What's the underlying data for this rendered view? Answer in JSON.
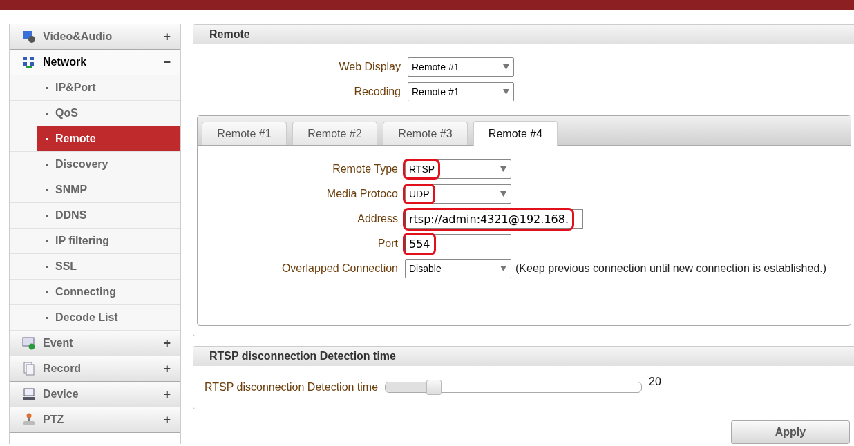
{
  "sidebar": {
    "sections": [
      {
        "kind": "video",
        "label": "Video&Audio",
        "toggle": "+",
        "expanded": false
      },
      {
        "kind": "network",
        "label": "Network",
        "toggle": "−",
        "expanded": true,
        "children": [
          {
            "label": "IP&Port",
            "selected": false
          },
          {
            "label": "QoS",
            "selected": false
          },
          {
            "label": "Remote",
            "selected": true
          },
          {
            "label": "Discovery",
            "selected": false
          },
          {
            "label": "SNMP",
            "selected": false
          },
          {
            "label": "DDNS",
            "selected": false
          },
          {
            "label": "IP filtering",
            "selected": false
          },
          {
            "label": "SSL",
            "selected": false
          },
          {
            "label": "Connecting",
            "selected": false
          },
          {
            "label": "Decode List",
            "selected": false
          }
        ]
      },
      {
        "kind": "event",
        "label": "Event",
        "toggle": "+",
        "expanded": false
      },
      {
        "kind": "record",
        "label": "Record",
        "toggle": "+",
        "expanded": false
      },
      {
        "kind": "device",
        "label": "Device",
        "toggle": "+",
        "expanded": false
      },
      {
        "kind": "ptz",
        "label": "PTZ",
        "toggle": "+",
        "expanded": false
      }
    ]
  },
  "remote_panel": {
    "title": "Remote",
    "fields": [
      {
        "kind": "select",
        "label": "Web Display",
        "value": "Remote #1"
      },
      {
        "kind": "select",
        "label": "Recoding",
        "value": "Remote #1"
      }
    ],
    "tabs": [
      {
        "label": "Remote #1",
        "selected": false
      },
      {
        "label": "Remote #2",
        "selected": false
      },
      {
        "label": "Remote #3",
        "selected": false
      },
      {
        "label": "Remote #4",
        "selected": true
      }
    ],
    "tab_fields": [
      {
        "kind": "select",
        "label": "Remote Type",
        "value": "RTSP",
        "highlighted": true
      },
      {
        "kind": "select",
        "label": "Media Protoco",
        "value": "UDP",
        "highlighted": true
      },
      {
        "kind": "text",
        "label": "Address",
        "value": "rtsp://admin:4321@192.168.",
        "highlighted": true
      },
      {
        "kind": "text",
        "label": "Port",
        "value": "554",
        "highlighted": true
      },
      {
        "kind": "select",
        "label": "Overlapped Connection",
        "value": "Disable",
        "highlighted": false,
        "note": "(Keep previous connection until new connection is established.)"
      }
    ]
  },
  "detection_panel": {
    "title": "RTSP disconnection Detection time",
    "slider": {
      "label": "RTSP disconnection Detection time",
      "level": 0.19,
      "reading": "20"
    }
  },
  "apply_button": "Apply"
}
